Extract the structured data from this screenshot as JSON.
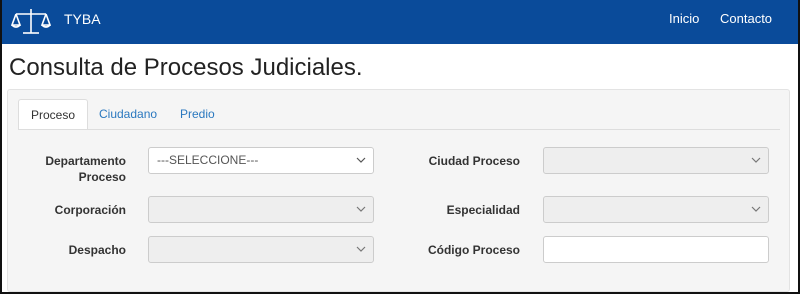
{
  "navbar": {
    "brand": "TYBA",
    "links": [
      "Inicio",
      "Contacto"
    ],
    "bg_color": "#0a4b9a"
  },
  "page": {
    "title": "Consulta de Procesos Judiciales."
  },
  "tabs": [
    {
      "label": "Proceso",
      "active": true
    },
    {
      "label": "Ciudadano",
      "active": false
    },
    {
      "label": "Predio",
      "active": false
    }
  ],
  "form": {
    "departamento": {
      "label_line1": "Departamento",
      "label_line2": "Proceso",
      "value": "---SELECCIONE---"
    },
    "ciudad": {
      "label": "Ciudad Proceso",
      "value": ""
    },
    "corporacion": {
      "label": "Corporación",
      "value": ""
    },
    "especialidad": {
      "label": "Especialidad",
      "value": ""
    },
    "despacho": {
      "label": "Despacho",
      "value": ""
    },
    "codigo": {
      "label": "Código Proceso",
      "value": ""
    }
  }
}
